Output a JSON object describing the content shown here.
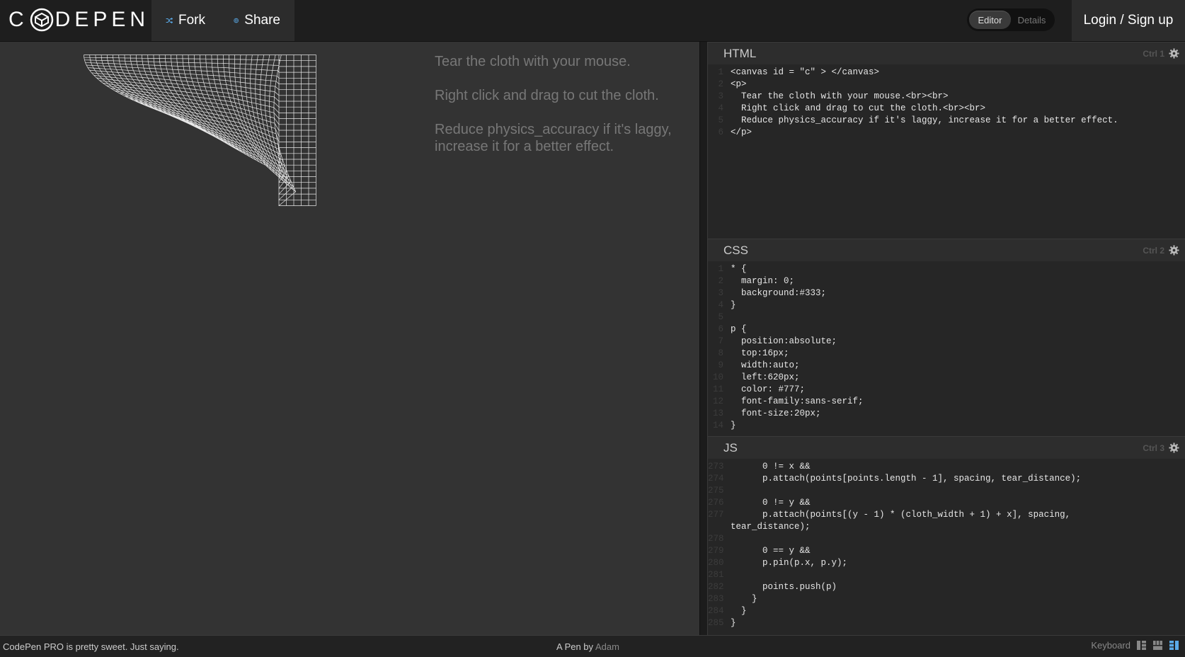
{
  "header": {
    "logo_text": "DEPEN",
    "fork_label": "Fork",
    "share_label": "Share",
    "toggle": {
      "editor": "Editor",
      "details": "Details",
      "active": "Editor"
    },
    "login_label": "Login / Sign up"
  },
  "preview": {
    "messages": [
      "Tear the cloth with your mouse.",
      "Right click and drag to cut the cloth.",
      "Reduce physics_accuracy if it's laggy, increase it for a better effect."
    ]
  },
  "editors": {
    "html": {
      "title": "HTML",
      "shortcut": "Ctrl 1"
    },
    "css": {
      "title": "CSS",
      "shortcut": "Ctrl 2"
    },
    "js": {
      "title": "JS",
      "shortcut": "Ctrl 3"
    }
  },
  "code_html": [
    {
      "n": "1",
      "t": "<canvas id = \"c\" > </canvas>"
    },
    {
      "n": "2",
      "t": "<p>"
    },
    {
      "n": "3",
      "t": "  Tear the cloth with your mouse.<br><br>"
    },
    {
      "n": "4",
      "t": "  Right click and drag to cut the cloth.<br><br>"
    },
    {
      "n": "5",
      "t": "  Reduce physics_accuracy if it's laggy, increase it for a better effect."
    },
    {
      "n": "6",
      "t": "</p>"
    }
  ],
  "code_css": [
    {
      "n": "1",
      "t": "* {"
    },
    {
      "n": "2",
      "t": "  margin: 0;"
    },
    {
      "n": "3",
      "t": "  background:#333;"
    },
    {
      "n": "4",
      "t": "}"
    },
    {
      "n": "5",
      "t": ""
    },
    {
      "n": "6",
      "t": "p {"
    },
    {
      "n": "7",
      "t": "  position:absolute;"
    },
    {
      "n": "8",
      "t": "  top:16px;"
    },
    {
      "n": "9",
      "t": "  width:auto;"
    },
    {
      "n": "10",
      "t": "  left:620px;"
    },
    {
      "n": "11",
      "t": "  color: #777;"
    },
    {
      "n": "12",
      "t": "  font-family:sans-serif;"
    },
    {
      "n": "13",
      "t": "  font-size:20px;"
    },
    {
      "n": "14",
      "t": "}"
    }
  ],
  "code_js": [
    {
      "n": "273",
      "t": "      0 != x &&"
    },
    {
      "n": "274",
      "t": "      p.attach(points[points.length - 1], spacing, tear_distance);"
    },
    {
      "n": "275",
      "t": ""
    },
    {
      "n": "276",
      "t": "      0 != y &&"
    },
    {
      "n": "277",
      "t": "      p.attach(points[(y - 1) * (cloth_width + 1) + x], spacing,"
    },
    {
      "n": "",
      "t": "tear_distance);"
    },
    {
      "n": "278",
      "t": ""
    },
    {
      "n": "279",
      "t": "      0 == y &&"
    },
    {
      "n": "280",
      "t": "      p.pin(p.x, p.y);"
    },
    {
      "n": "281",
      "t": ""
    },
    {
      "n": "282",
      "t": "      points.push(p)"
    },
    {
      "n": "283",
      "t": "    }"
    },
    {
      "n": "284",
      "t": "  }"
    },
    {
      "n": "285",
      "t": "}"
    }
  ],
  "footer": {
    "promo": "CodePen PRO is pretty sweet. Just saying.",
    "by_prefix": "A Pen by",
    "author": "Adam",
    "keyboard": "Keyboard"
  }
}
